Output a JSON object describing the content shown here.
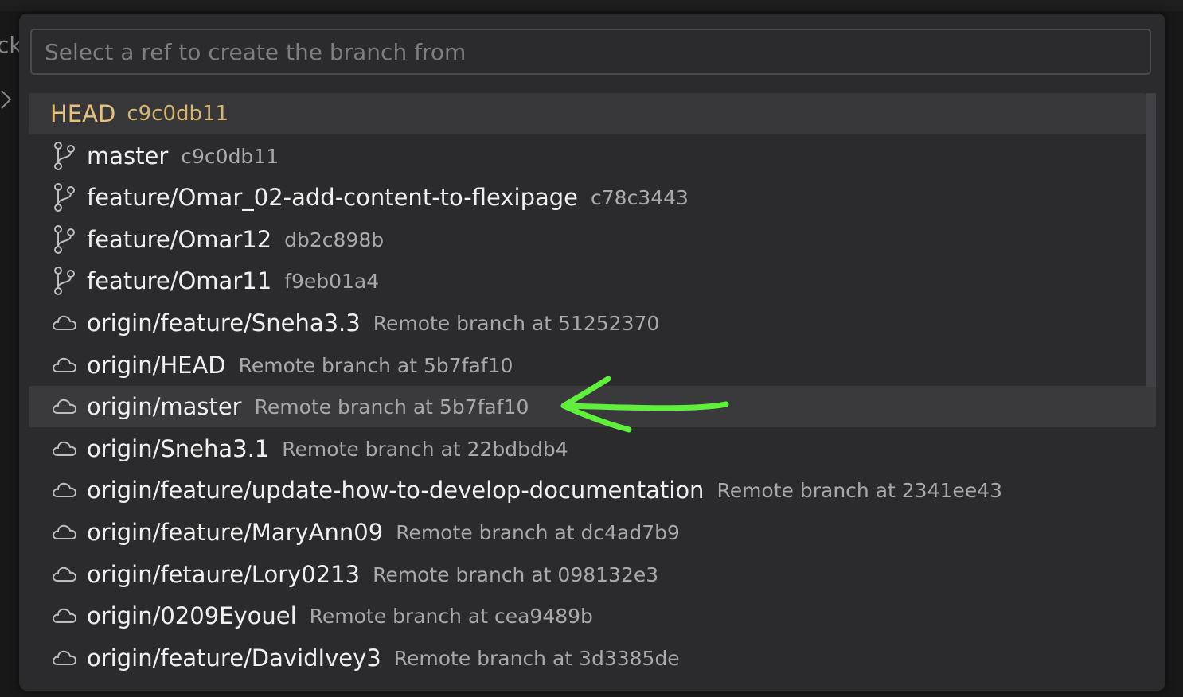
{
  "background": {
    "partial_text": "ck"
  },
  "quick_pick": {
    "placeholder": "Select a ref to create the branch from",
    "value": "",
    "items": [
      {
        "label": "HEAD",
        "description": "c9c0db11",
        "icon": "none"
      },
      {
        "label": "master",
        "description": "c9c0db11",
        "icon": "git-branch-icon"
      },
      {
        "label": "feature/Omar_02-add-content-to-flexipage",
        "description": "c78c3443",
        "icon": "git-branch-icon"
      },
      {
        "label": "feature/Omar12",
        "description": "db2c898b",
        "icon": "git-branch-icon"
      },
      {
        "label": "feature/Omar11",
        "description": "f9eb01a4",
        "icon": "git-branch-icon"
      },
      {
        "label": "origin/feature/Sneha3.3",
        "description": "Remote branch at 51252370",
        "icon": "cloud-icon"
      },
      {
        "label": "origin/HEAD",
        "description": "Remote branch at 5b7faf10",
        "icon": "cloud-icon"
      },
      {
        "label": "origin/master",
        "description": "Remote branch at 5b7faf10",
        "icon": "cloud-icon"
      },
      {
        "label": "origin/Sneha3.1",
        "description": "Remote branch at 22bdbdb4",
        "icon": "cloud-icon"
      },
      {
        "label": "origin/feature/update-how-to-develop-documentation",
        "description": "Remote branch at 2341ee43",
        "icon": "cloud-icon"
      },
      {
        "label": "origin/feature/MaryAnn09",
        "description": "Remote branch at dc4ad7b9",
        "icon": "cloud-icon"
      },
      {
        "label": "origin/fetaure/Lory0213",
        "description": "Remote branch at 098132e3",
        "icon": "cloud-icon"
      },
      {
        "label": "origin/0209Eyouel",
        "description": "Remote branch at cea9489b",
        "icon": "cloud-icon"
      },
      {
        "label": "origin/feature/DavidIvey3",
        "description": "Remote branch at 3d3385de",
        "icon": "cloud-icon"
      }
    ],
    "focused_index": 7
  },
  "colors": {
    "head_label": "#e5c07b",
    "annotation_arrow": "#5ef03a"
  }
}
